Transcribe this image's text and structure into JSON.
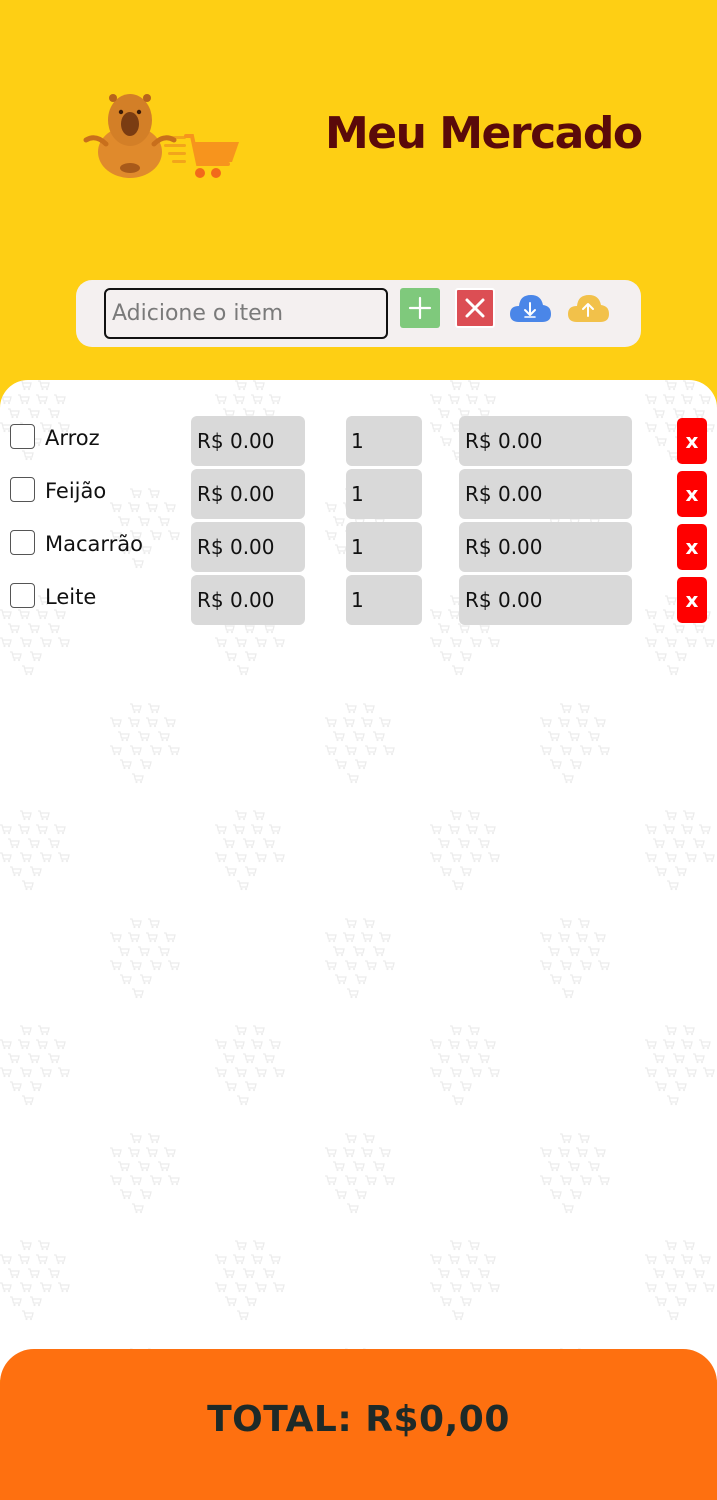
{
  "header": {
    "title": "Meu Mercado"
  },
  "toolbar": {
    "input_placeholder": "Adicione o item",
    "input_value": "",
    "add_icon": "plus-icon",
    "clear_icon": "close-icon",
    "download_icon": "cloud-download-icon",
    "upload_icon": "cloud-upload-icon"
  },
  "items": [
    {
      "name": "Arroz",
      "checked": false,
      "price": "R$ 0.00",
      "quantity": "1",
      "total": "R$ 0.00",
      "remove_label": "x"
    },
    {
      "name": "Feijão",
      "checked": false,
      "price": "R$ 0.00",
      "quantity": "1",
      "total": "R$ 0.00",
      "remove_label": "x"
    },
    {
      "name": "Macarrão",
      "checked": false,
      "price": "R$ 0.00",
      "quantity": "1",
      "total": "R$ 0.00",
      "remove_label": "x"
    },
    {
      "name": "Leite",
      "checked": false,
      "price": "R$ 0.00",
      "quantity": "1",
      "total": "R$ 0.00",
      "remove_label": "x"
    }
  ],
  "footer": {
    "total_label": "TOTAL: R$0,00"
  },
  "colors": {
    "header_bg": "#FECF14",
    "title": "#5a0a0a",
    "add_button": "#7fc97c",
    "clear_button": "#dc4e54",
    "delete_button": "#ff0000",
    "field_bg": "#d9d9d9",
    "footer_bg": "#FE7010"
  }
}
